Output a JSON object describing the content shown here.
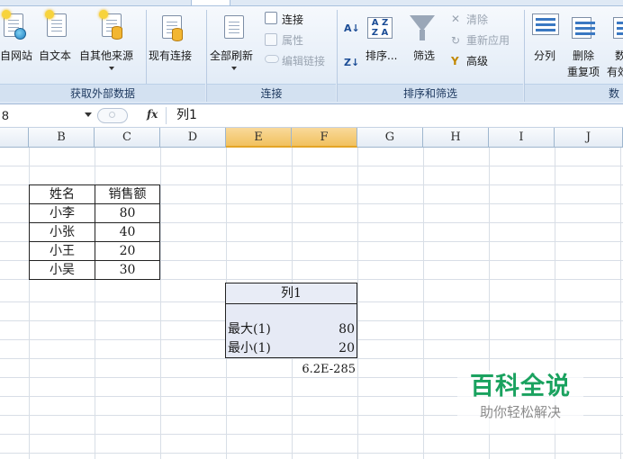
{
  "ribbon": {
    "groups": {
      "get_external": {
        "label": "获取外部数据",
        "buttons": [
          "自网站",
          "自文本",
          "自其他来源",
          "现有连接"
        ]
      },
      "connections": {
        "label": "连接",
        "refresh_all": "全部刷新",
        "connect": "连接",
        "properties": "属性",
        "edit_links": "编辑链接"
      },
      "sort_filter": {
        "label": "排序和筛选",
        "sort": "排序...",
        "filter": "筛选",
        "clear": "清除",
        "reapply": "重新应用",
        "advanced": "高级"
      },
      "data_tools": {
        "label": "数",
        "text_to_columns": "分列",
        "remove_dup_line1": "删除",
        "remove_dup_line2": "重复项",
        "partial": "数",
        "partial2": "有效"
      }
    }
  },
  "formula_bar": {
    "name_box": "8",
    "fx": "fx",
    "content": "列1"
  },
  "columns": [
    "B",
    "C",
    "D",
    "E",
    "F",
    "G",
    "H",
    "I",
    "J"
  ],
  "table": {
    "headers": [
      "姓名",
      "销售额"
    ],
    "rows": [
      [
        "小李",
        "80"
      ],
      [
        "小张",
        "40"
      ],
      [
        "小王",
        "20"
      ],
      [
        "小吴",
        "30"
      ]
    ]
  },
  "output": {
    "header": "列1",
    "rows": [
      [
        "最大(1)",
        "80"
      ],
      [
        "最小(1)",
        "20"
      ]
    ],
    "extra_value": "6.2E-285"
  },
  "watermark": {
    "title": "百科全说",
    "subtitle": "助你轻松解决"
  }
}
